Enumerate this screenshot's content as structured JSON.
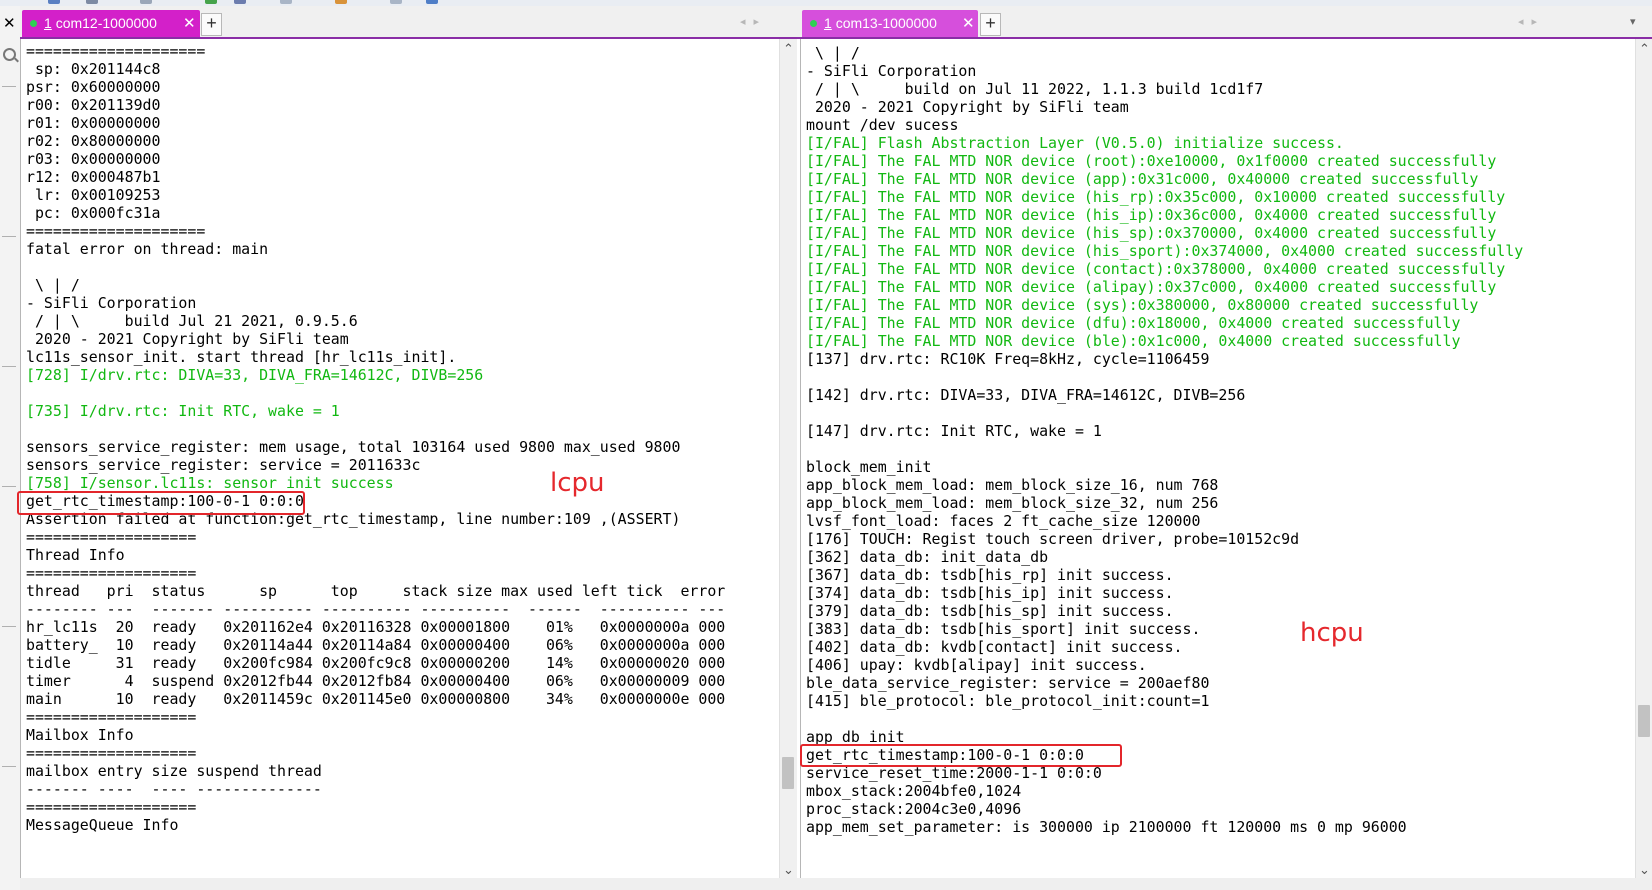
{
  "left_pane": {
    "tab": {
      "num": "1",
      "title": "com12-1000000",
      "close": "✕"
    },
    "tab_color": "#d320c9",
    "plus": "+",
    "nav_arrows": "◂▸",
    "lines": [
      {
        "text": "====================",
        "color": "black"
      },
      {
        "text": " sp: 0x201144c8",
        "color": "black"
      },
      {
        "text": "psr: 0x60000000",
        "color": "black"
      },
      {
        "text": "r00: 0x201139d0",
        "color": "black"
      },
      {
        "text": "r01: 0x00000000",
        "color": "black"
      },
      {
        "text": "r02: 0x80000000",
        "color": "black"
      },
      {
        "text": "r03: 0x00000000",
        "color": "black"
      },
      {
        "text": "r12: 0x000487b1",
        "color": "black"
      },
      {
        "text": " lr: 0x00109253",
        "color": "black"
      },
      {
        "text": " pc: 0x000fc31a",
        "color": "black"
      },
      {
        "text": "====================",
        "color": "black"
      },
      {
        "text": "fatal error on thread: main",
        "color": "black"
      },
      {
        "text": "",
        "color": "black"
      },
      {
        "text": " \\ | /",
        "color": "black"
      },
      {
        "text": "- SiFli Corporation",
        "color": "black"
      },
      {
        "text": " / | \\     build Jul 21 2021, 0.9.5.6",
        "color": "black"
      },
      {
        "text": " 2020 - 2021 Copyright by SiFli team",
        "color": "black"
      },
      {
        "text": "lc11s_sensor_init. start thread [hr_lc11s_init].",
        "color": "black"
      },
      {
        "text": "[728] I/drv.rtc: DIVA=33, DIVA_FRA=14612C, DIVB=256",
        "color": "green"
      },
      {
        "text": "",
        "color": "black"
      },
      {
        "text": "[735] I/drv.rtc: Init RTC, wake = 1",
        "color": "green"
      },
      {
        "text": "",
        "color": "black"
      },
      {
        "text": "sensors_service_register: mem usage, total 103164 used 9800 max_used 9800",
        "color": "black"
      },
      {
        "text": "sensors_service_register: service = 2011633c",
        "color": "black"
      },
      {
        "text": "[758] I/sensor.lc11s: sensor init success",
        "color": "green"
      },
      {
        "text": "get_rtc_timestamp:100-0-1 0:0:0",
        "color": "black"
      },
      {
        "text": "Assertion failed at function:get_rtc_timestamp, line number:109 ,(ASSERT)",
        "color": "black"
      },
      {
        "text": "===================",
        "color": "black"
      },
      {
        "text": "Thread Info",
        "color": "black"
      },
      {
        "text": "===================",
        "color": "black"
      },
      {
        "text": "thread   pri  status      sp      top     stack size max used left tick  error",
        "color": "black"
      },
      {
        "text": "-------- ---  ------- ---------- ---------- ----------  ------  ---------- ---",
        "color": "black"
      },
      {
        "text": "hr_lc11s  20  ready   0x201162e4 0x20116328 0x00001800    01%   0x0000000a 000",
        "color": "black"
      },
      {
        "text": "battery_  10  ready   0x20114a44 0x20114a84 0x00000400    06%   0x0000000a 000",
        "color": "black"
      },
      {
        "text": "tidle     31  ready   0x200fc984 0x200fc9c8 0x00000200    14%   0x00000020 000",
        "color": "black"
      },
      {
        "text": "timer      4  suspend 0x2012fb44 0x2012fb84 0x00000400    06%   0x00000009 000",
        "color": "black"
      },
      {
        "text": "main      10  ready   0x2011459c 0x201145e0 0x00000800    34%   0x0000000e 000",
        "color": "black"
      },
      {
        "text": "===================",
        "color": "black"
      },
      {
        "text": "Mailbox Info",
        "color": "black"
      },
      {
        "text": "===================",
        "color": "black"
      },
      {
        "text": "mailbox entry size suspend thread",
        "color": "black"
      },
      {
        "text": "------- ----  ---- --------------",
        "color": "black"
      },
      {
        "text": "===================",
        "color": "black"
      },
      {
        "text": "MessageQueue Info",
        "color": "black"
      }
    ],
    "annotation": "lcpu"
  },
  "right_pane": {
    "tab": {
      "num": "1",
      "title": "com13-1000000",
      "close": "✕"
    },
    "tab_color": "#d64fdc",
    "plus": "+",
    "nav_arrows": "◂▸",
    "lines": [
      {
        "text": " \\ | /",
        "color": "black"
      },
      {
        "text": "- SiFli Corporation",
        "color": "black"
      },
      {
        "text": " / | \\     build on Jul 11 2022, 1.1.3 build 1cd1f7",
        "color": "black"
      },
      {
        "text": " 2020 - 2021 Copyright by SiFli team",
        "color": "black"
      },
      {
        "text": "mount /dev sucess",
        "color": "black"
      },
      {
        "text": "[I/FAL] Flash Abstraction Layer (V0.5.0) initialize success.",
        "color": "green"
      },
      {
        "text": "[I/FAL] The FAL MTD NOR device (root):0xe10000, 0x1f0000 created successfully",
        "color": "green"
      },
      {
        "text": "[I/FAL] The FAL MTD NOR device (app):0x31c000, 0x40000 created successfully",
        "color": "green"
      },
      {
        "text": "[I/FAL] The FAL MTD NOR device (his_rp):0x35c000, 0x10000 created successfully",
        "color": "green"
      },
      {
        "text": "[I/FAL] The FAL MTD NOR device (his_ip):0x36c000, 0x4000 created successfully",
        "color": "green"
      },
      {
        "text": "[I/FAL] The FAL MTD NOR device (his_sp):0x370000, 0x4000 created successfully",
        "color": "green"
      },
      {
        "text": "[I/FAL] The FAL MTD NOR device (his_sport):0x374000, 0x4000 created successfully",
        "color": "green"
      },
      {
        "text": "[I/FAL] The FAL MTD NOR device (contact):0x378000, 0x4000 created successfully",
        "color": "green"
      },
      {
        "text": "[I/FAL] The FAL MTD NOR device (alipay):0x37c000, 0x4000 created successfully",
        "color": "green"
      },
      {
        "text": "[I/FAL] The FAL MTD NOR device (sys):0x380000, 0x80000 created successfully",
        "color": "green"
      },
      {
        "text": "[I/FAL] The FAL MTD NOR device (dfu):0x18000, 0x4000 created successfully",
        "color": "green"
      },
      {
        "text": "[I/FAL] The FAL MTD NOR device (ble):0x1c000, 0x4000 created successfully",
        "color": "green"
      },
      {
        "text": "[137] drv.rtc: RC10K Freq=8kHz, cycle=1106459",
        "color": "black"
      },
      {
        "text": "",
        "color": "black"
      },
      {
        "text": "[142] drv.rtc: DIVA=33, DIVA_FRA=14612C, DIVB=256",
        "color": "black"
      },
      {
        "text": "",
        "color": "black"
      },
      {
        "text": "[147] drv.rtc: Init RTC, wake = 1",
        "color": "black"
      },
      {
        "text": "",
        "color": "black"
      },
      {
        "text": "block_mem_init",
        "color": "black"
      },
      {
        "text": "app_block_mem_load: mem_block_size_16, num 768",
        "color": "black"
      },
      {
        "text": "app_block_mem_load: mem_block_size_32, num 256",
        "color": "black"
      },
      {
        "text": "lvsf_font_load: faces 2 ft_cache_size 120000",
        "color": "black"
      },
      {
        "text": "[176] TOUCH: Regist touch screen driver, probe=10152c9d",
        "color": "black"
      },
      {
        "text": "[362] data_db: init_data_db",
        "color": "black"
      },
      {
        "text": "[367] data_db: tsdb[his_rp] init success.",
        "color": "black"
      },
      {
        "text": "[374] data_db: tsdb[his_ip] init success.",
        "color": "black"
      },
      {
        "text": "[379] data_db: tsdb[his_sp] init success.",
        "color": "black"
      },
      {
        "text": "[383] data_db: tsdb[his_sport] init success.",
        "color": "black"
      },
      {
        "text": "[402] data_db: kvdb[contact] init success.",
        "color": "black"
      },
      {
        "text": "[406] upay: kvdb[alipay] init success.",
        "color": "black"
      },
      {
        "text": "ble_data_service_register: service = 200aef80",
        "color": "black"
      },
      {
        "text": "[415] ble_protocol: ble_protocol_init:count=1",
        "color": "black"
      },
      {
        "text": "",
        "color": "black"
      },
      {
        "text": "app_db_init",
        "color": "black"
      },
      {
        "text": "get_rtc_timestamp:100-0-1 0:0:0",
        "color": "black"
      },
      {
        "text": "service_reset_time:2000-1-1 0:0:0",
        "color": "black"
      },
      {
        "text": "mbox_stack:2004bfe0,1024",
        "color": "black"
      },
      {
        "text": "proc_stack:2004c3e0,4096",
        "color": "black"
      },
      {
        "text": "app_mem_set_parameter: is 300000 ip 2100000 ft 120000 ms 0 mp 96000",
        "color": "black"
      }
    ],
    "annotation": "hcpu"
  },
  "scroll": {
    "left_position": 0.92,
    "right_position": 0.96
  },
  "colors": {
    "green_text": "#12b812",
    "highlight": "#e3262b",
    "tab_underline": "#8a2ea6"
  },
  "icons": [
    "close-icon",
    "search-icon",
    "scroll-up-icon",
    "scroll-down-icon",
    "dropdown-icon"
  ]
}
